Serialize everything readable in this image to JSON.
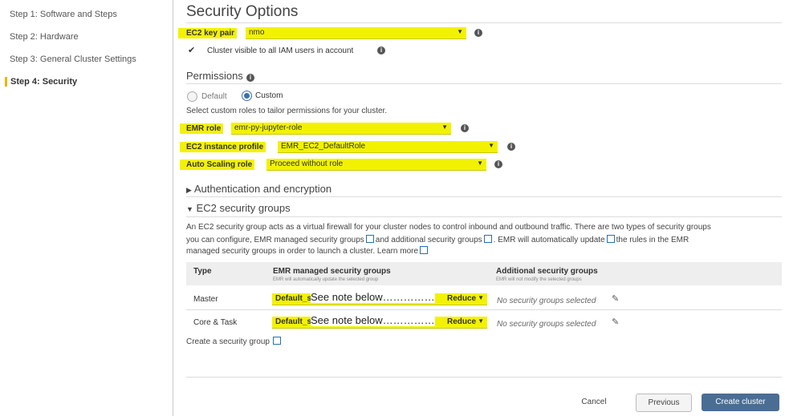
{
  "sidebar": {
    "steps": [
      {
        "label": "Step 1: Software and Steps"
      },
      {
        "label": "Step 2: Hardware"
      },
      {
        "label": "Step 3: General Cluster Settings"
      },
      {
        "label": "Step 4: Security"
      }
    ]
  },
  "main": {
    "title": "Security Options",
    "ec2_key_pair": {
      "label": "EC2 key pair",
      "value": "nmo"
    },
    "cluster_visible": {
      "label": "Cluster visible to all IAM users in account",
      "checked": true
    },
    "permissions": {
      "title": "Permissions",
      "options": [
        "Default",
        "Custom"
      ],
      "selected": "Custom",
      "hint": "Select custom roles to tailor permissions for your cluster.",
      "emr_role": {
        "label": "EMR role",
        "value": "emr-py-jupyter-role"
      },
      "instance_profile": {
        "label": "EC2 instance profile",
        "value": "EMR_EC2_DefaultRole"
      },
      "autoscaling_role": {
        "label": "Auto Scaling role",
        "value": "Proceed without role"
      }
    },
    "auth_section": {
      "title": "Authentication and encryption"
    },
    "sg_section": {
      "title": "EC2 security groups",
      "desc_1": "An EC2 security group acts as a virtual firewall for your cluster nodes to control inbound and outbound traffic. There are two types of security groups",
      "desc_2a": "you can configure, EMR managed security groups",
      "desc_2b": "and additional security groups",
      "desc_2c": ". EMR will automatically update",
      "desc_2d": "the rules in the EMR",
      "desc_3": "managed security groups in order to launch a cluster. Learn more",
      "table": {
        "headers": {
          "type": "Type",
          "emr": "EMR managed security groups",
          "emr_sub": "EMR will automatically update the selected group",
          "additional": "Additional security groups",
          "additional_sub": "EMR will not modify the selected groups"
        },
        "rows": [
          {
            "type": "Master",
            "select_left": "Default_s",
            "select_right": "Reduce",
            "note": "See note below……………",
            "additional": "No security groups selected"
          },
          {
            "type": "Core & Task",
            "select_left": "Default_s",
            "select_right": "Reduce",
            "note": "See note below……………",
            "additional": "No security groups selected"
          }
        ]
      },
      "create_link": "Create a security group"
    },
    "buttons": {
      "cancel": "Cancel",
      "previous": "Previous",
      "create": "Create cluster"
    }
  },
  "colors": {
    "highlight": "#f2f200",
    "primary": "#4a6d94",
    "active_step": "#f0b400"
  },
  "icons": [
    "info-icon",
    "external-link-icon",
    "pencil-icon",
    "chevron-down-icon",
    "caret-right-icon",
    "caret-down-icon",
    "checkmark-icon"
  ]
}
